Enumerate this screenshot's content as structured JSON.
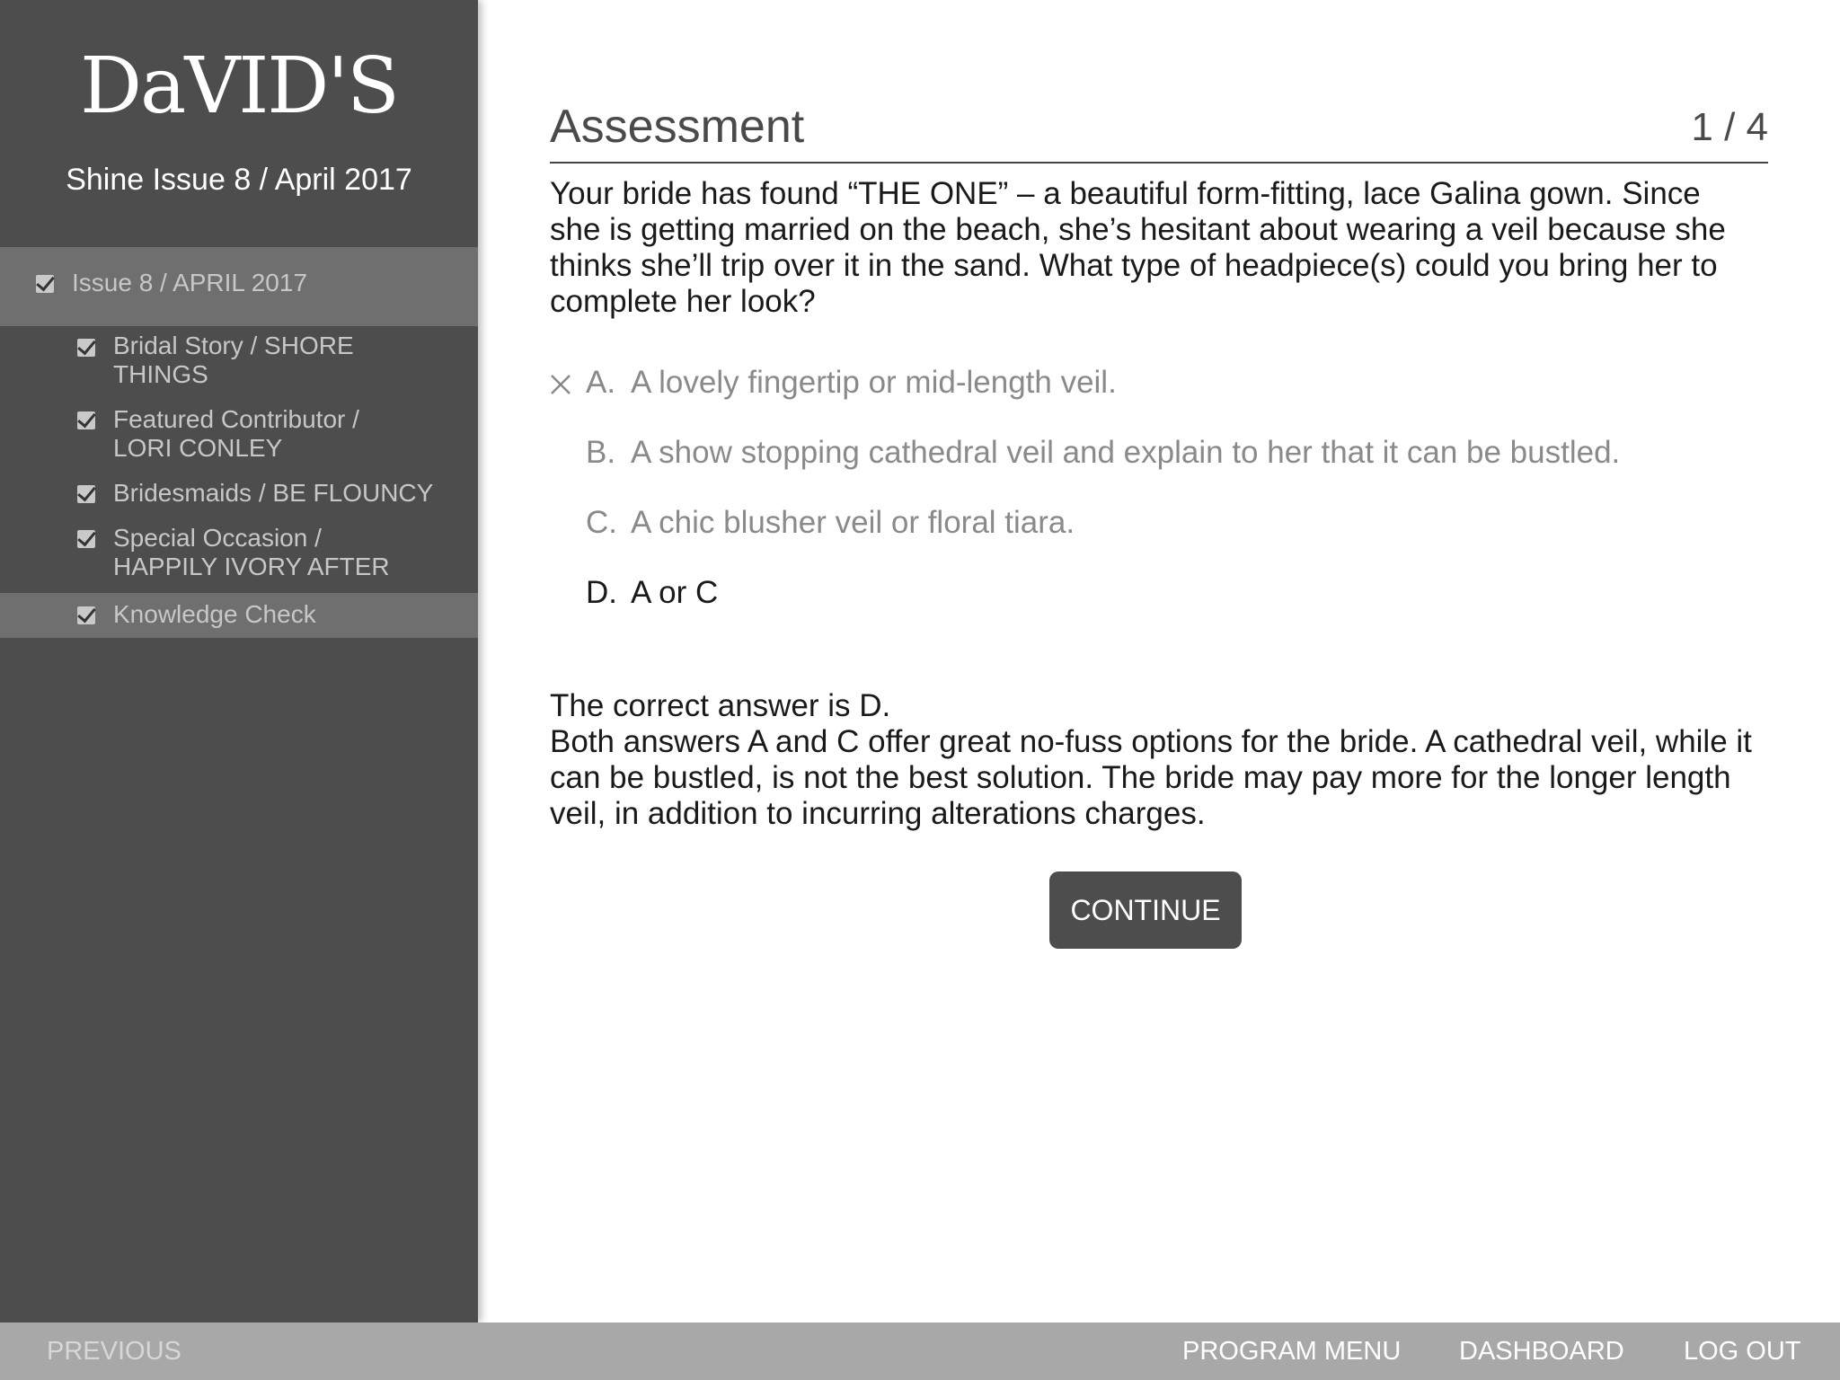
{
  "sidebar": {
    "logo_text": "DaVID'S",
    "issue_title": "Shine Issue 8 / April 2017",
    "top_item": "Issue 8 / APRIL 2017",
    "items": [
      {
        "label": "Bridal Story / SHORE THINGS"
      },
      {
        "label": "Featured Contributor / LORI CONLEY"
      },
      {
        "label": "Bridesmaids / BE FLOUNCY"
      },
      {
        "label": "Special Occasion / HAPPILY IVORY AFTER"
      },
      {
        "label": "Knowledge Check"
      }
    ]
  },
  "assessment": {
    "heading": "Assessment",
    "counter": "1 / 4",
    "question": "Your bride has found “THE ONE” – a beautiful form-fitting, lace Galina gown. Since she is getting married on the beach, she’s hesitant about wearing a veil because she thinks she’ll trip over it in the sand. What type of headpiece(s) could you bring her to complete her look?",
    "options": [
      {
        "letter": "A.",
        "text": "A lovely fingertip or mid-length veil."
      },
      {
        "letter": "B.",
        "text": "A show stopping cathedral veil and explain to her that it can be bustled."
      },
      {
        "letter": "C.",
        "text": "A chic blusher veil or floral tiara."
      },
      {
        "letter": "D.",
        "text": "A or C"
      }
    ],
    "feedback_title": "The correct answer is D.",
    "feedback_body": "Both answers A and C offer great no-fuss options for the bride. A cathedral veil, while it can be bustled, is not the best solution. The bride may pay more for the longer length veil, in addition to incurring alterations charges.",
    "continue_label": "CONTINUE"
  },
  "footer": {
    "previous": "PREVIOUS",
    "program_menu": "PROGRAM MENU",
    "dashboard": "DASHBOARD",
    "logout": "LOG OUT"
  }
}
